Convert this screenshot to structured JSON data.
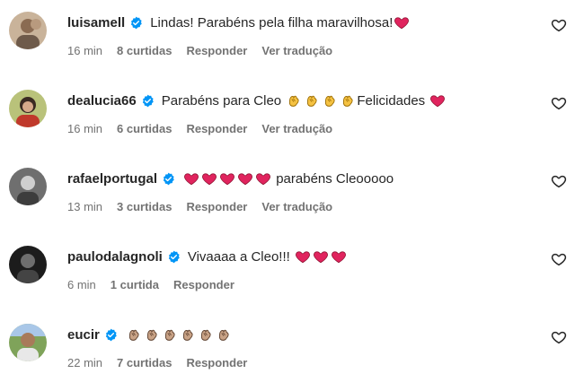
{
  "comments": [
    {
      "username": "luisamell",
      "verified": true,
      "avatar": "avatar-photo-woman",
      "parts": [
        {
          "type": "text",
          "value": "Lindas! Parabéns pela filha maravilhosa!"
        },
        {
          "type": "emoji",
          "name": "red-heart"
        }
      ],
      "time": "16 min",
      "likes": "8 curtidas",
      "reply": "Responder",
      "translate": "Ver tradução"
    },
    {
      "username": "dealucia66",
      "verified": true,
      "avatar": "avatar-photo-woman-red",
      "parts": [
        {
          "type": "text",
          "value": "Parabéns para Cleo "
        },
        {
          "type": "emoji",
          "name": "clapping-hands"
        },
        {
          "type": "emoji",
          "name": "clapping-hands"
        },
        {
          "type": "emoji",
          "name": "clapping-hands"
        },
        {
          "type": "emoji",
          "name": "clapping-hands"
        },
        {
          "type": "text",
          "value": "Felicidades "
        },
        {
          "type": "emoji",
          "name": "red-heart"
        }
      ],
      "time": "16 min",
      "likes": "6 curtidas",
      "reply": "Responder",
      "translate": "Ver tradução"
    },
    {
      "username": "rafaelportugal",
      "verified": true,
      "avatar": "avatar-photo-man-gray",
      "parts": [
        {
          "type": "emoji",
          "name": "red-heart"
        },
        {
          "type": "emoji",
          "name": "red-heart"
        },
        {
          "type": "emoji",
          "name": "red-heart"
        },
        {
          "type": "emoji",
          "name": "red-heart"
        },
        {
          "type": "emoji",
          "name": "red-heart"
        },
        {
          "type": "text",
          "value": " parabéns Cleooooo"
        }
      ],
      "time": "13 min",
      "likes": "3 curtidas",
      "reply": "Responder",
      "translate": "Ver tradução"
    },
    {
      "username": "paulodalagnoli",
      "verified": true,
      "avatar": "avatar-photo-man-dark",
      "parts": [
        {
          "type": "text",
          "value": "Vivaaaa a Cleo!!! "
        },
        {
          "type": "emoji",
          "name": "red-heart"
        },
        {
          "type": "emoji",
          "name": "red-heart"
        },
        {
          "type": "emoji",
          "name": "red-heart"
        }
      ],
      "time": "6 min",
      "likes": "1 curtida",
      "reply": "Responder",
      "translate": ""
    },
    {
      "username": "eucir",
      "verified": true,
      "avatar": "avatar-photo-man-outdoor",
      "parts": [
        {
          "type": "emoji",
          "name": "clapping-hands-medium"
        },
        {
          "type": "emoji",
          "name": "clapping-hands-medium"
        },
        {
          "type": "emoji",
          "name": "clapping-hands-medium"
        },
        {
          "type": "emoji",
          "name": "clapping-hands-medium"
        },
        {
          "type": "emoji",
          "name": "clapping-hands-medium"
        },
        {
          "type": "emoji",
          "name": "clapping-hands-medium"
        }
      ],
      "time": "22 min",
      "likes": "7 curtidas",
      "reply": "Responder",
      "translate": ""
    }
  ],
  "colors": {
    "text": "#262626",
    "meta": "#737373",
    "verified": "#0095f6",
    "heart": "#e0245e"
  }
}
